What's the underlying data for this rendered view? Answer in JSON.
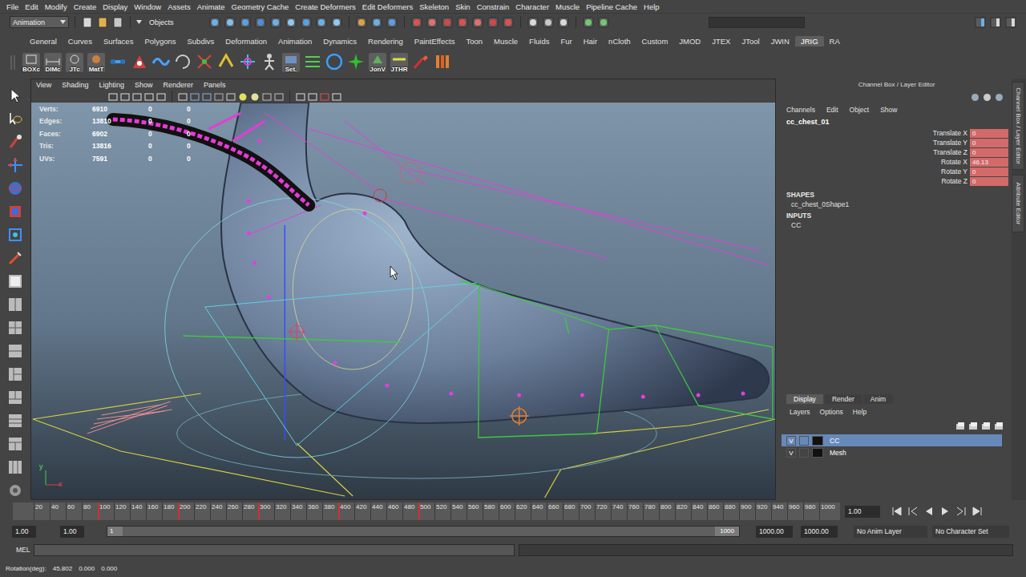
{
  "menubar": [
    "File",
    "Edit",
    "Modify",
    "Create",
    "Display",
    "Window",
    "Assets",
    "Animate",
    "Geometry Cache",
    "Create Deformers",
    "Edit Deformers",
    "Skeleton",
    "Skin",
    "Constrain",
    "Character",
    "Muscle",
    "Pipeline Cache",
    "Help"
  ],
  "status_line": {
    "mode": "Animation",
    "selection_mode": "Objects"
  },
  "shelf": {
    "tabs": [
      {
        "label": "General",
        "selected": false
      },
      {
        "label": "Curves",
        "selected": false
      },
      {
        "label": "Surfaces",
        "selected": false
      },
      {
        "label": "Polygons",
        "selected": false
      },
      {
        "label": "Subdivs",
        "selected": false
      },
      {
        "label": "Deformation",
        "selected": false
      },
      {
        "label": "Animation",
        "selected": false
      },
      {
        "label": "Dynamics",
        "selected": false
      },
      {
        "label": "Rendering",
        "selected": false
      },
      {
        "label": "PaintEffects",
        "selected": false
      },
      {
        "label": "Toon",
        "selected": false
      },
      {
        "label": "Muscle",
        "selected": false
      },
      {
        "label": "Fluids",
        "selected": false
      },
      {
        "label": "Fur",
        "selected": false
      },
      {
        "label": "Hair",
        "selected": false
      },
      {
        "label": "nCloth",
        "selected": false
      },
      {
        "label": "Custom",
        "selected": false
      },
      {
        "label": "JMOD",
        "selected": false
      },
      {
        "label": "JTEX",
        "selected": false
      },
      {
        "label": "JTool",
        "selected": false
      },
      {
        "label": "JWIN",
        "selected": false
      },
      {
        "label": "JRIG",
        "selected": true
      },
      {
        "label": "RA",
        "selected": false
      }
    ],
    "buttons": [
      {
        "kind": "labeled",
        "label": "BOXc"
      },
      {
        "kind": "labeled",
        "label": "DIMc"
      },
      {
        "kind": "labeled",
        "label": "JTc"
      },
      {
        "kind": "labeled",
        "label": "MatT"
      },
      {
        "kind": "icon"
      },
      {
        "kind": "icon"
      },
      {
        "kind": "icon"
      },
      {
        "kind": "icon"
      },
      {
        "kind": "icon"
      },
      {
        "kind": "icon"
      },
      {
        "kind": "icon"
      },
      {
        "kind": "icon"
      },
      {
        "kind": "labeled",
        "label": "Set."
      },
      {
        "kind": "icon"
      },
      {
        "kind": "icon"
      },
      {
        "kind": "icon"
      },
      {
        "kind": "labeled",
        "label": "JonV"
      },
      {
        "kind": "labeled",
        "label": "JTHR"
      },
      {
        "kind": "icon"
      },
      {
        "kind": "icon"
      }
    ]
  },
  "viewport": {
    "menu": [
      "View",
      "Shading",
      "Lighting",
      "Show",
      "Renderer",
      "Panels"
    ],
    "hud": [
      {
        "label": "Verts:",
        "values": [
          "6910",
          "0",
          "0"
        ]
      },
      {
        "label": "Edges:",
        "values": [
          "13810",
          "0",
          "0"
        ]
      },
      {
        "label": "Faces:",
        "values": [
          "6902",
          "0",
          "0"
        ]
      },
      {
        "label": "Tris:",
        "values": [
          "13816",
          "0",
          "0"
        ]
      },
      {
        "label": "UVs:",
        "values": [
          "7591",
          "0",
          "0"
        ]
      }
    ],
    "axis": {
      "y": "y",
      "x": "x"
    }
  },
  "channel_box": {
    "title": "Channel Box / Layer Editor",
    "menu": [
      "Channels",
      "Edit",
      "Object",
      "Show"
    ],
    "object": "cc_chest_01",
    "attributes": [
      {
        "name": "Translate X",
        "value": "0",
        "keyed": true
      },
      {
        "name": "Translate Y",
        "value": "0",
        "keyed": true
      },
      {
        "name": "Translate Z",
        "value": "0",
        "keyed": true
      },
      {
        "name": "Rotate X",
        "value": "46.13",
        "keyed": true
      },
      {
        "name": "Rotate Y",
        "value": "0",
        "keyed": true
      },
      {
        "name": "Rotate Z",
        "value": "0",
        "keyed": true
      }
    ],
    "shapes_header": "SHAPES",
    "shapes": [
      "cc_chest_0Shape1"
    ],
    "inputs_header": "INPUTS",
    "inputs": [
      "CC"
    ]
  },
  "layer_editor": {
    "tabs": [
      {
        "label": "Display",
        "selected": true
      },
      {
        "label": "Render",
        "selected": false
      },
      {
        "label": "Anim",
        "selected": false
      }
    ],
    "menu": [
      "Layers",
      "Options",
      "Help"
    ],
    "layers": [
      {
        "visibility": "V",
        "name": "CC",
        "selected": true
      },
      {
        "visibility": "V",
        "name": "Mesh",
        "selected": false
      }
    ]
  },
  "side_tabs": [
    "Channel Box / Layer Editor",
    "Attribute Editor"
  ],
  "timeline": {
    "ticks": [
      "20",
      "40",
      "60",
      "80",
      "100",
      "120",
      "140",
      "160",
      "180",
      "200",
      "220",
      "240",
      "260",
      "280",
      "300",
      "320",
      "340",
      "360",
      "380",
      "400",
      "420",
      "440",
      "460",
      "480",
      "500",
      "520",
      "540",
      "560",
      "580",
      "600",
      "620",
      "640",
      "660",
      "680",
      "700",
      "720",
      "740",
      "760",
      "780",
      "800",
      "820",
      "840",
      "860",
      "880",
      "900",
      "920",
      "940",
      "960",
      "980",
      "1000"
    ],
    "keys": [
      100,
      200,
      300,
      400,
      500
    ],
    "current_time": "1.00"
  },
  "range": {
    "start": "1.00",
    "playback_start": "1.00",
    "slider_start": "1",
    "slider_end": "1000",
    "playback_end": "1000.00",
    "end": "1000.00",
    "anim_layer": "No Anim Layer",
    "character_set": "No Character Set"
  },
  "command_line": {
    "language": "MEL"
  },
  "help_line": {
    "label": "Rotation(deg):",
    "values": [
      "45.802",
      "0.000",
      "0.000"
    ]
  }
}
